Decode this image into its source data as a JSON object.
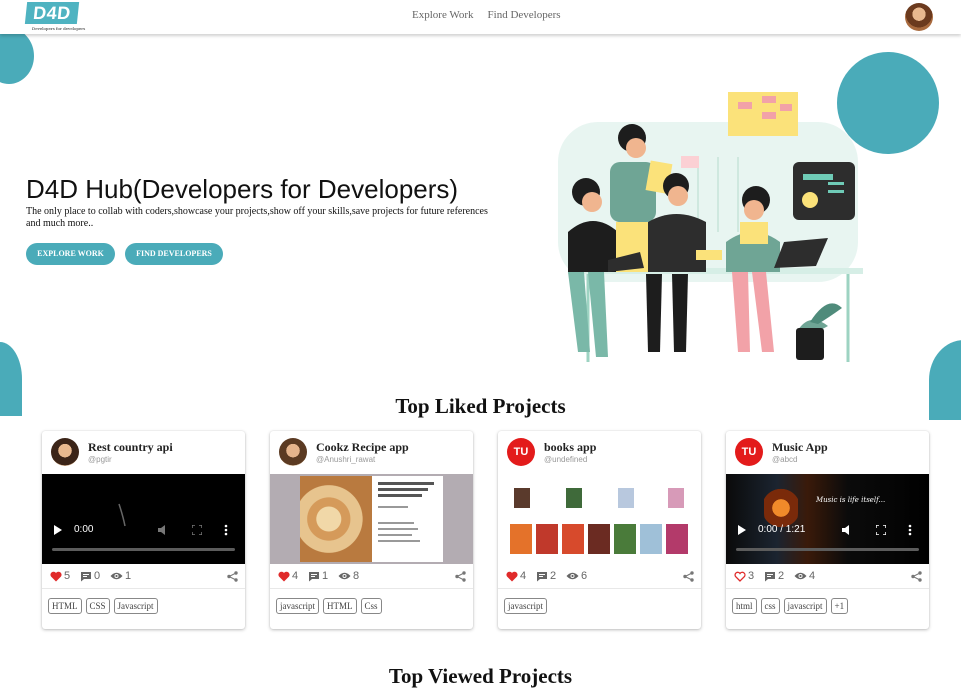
{
  "nav": {
    "logo_text": "D4D",
    "logo_tagline": "Developers for developers",
    "links": [
      "Explore Work",
      "Find Developers"
    ]
  },
  "hero": {
    "title": "D4D Hub(Developers for Developers)",
    "subtitle": "The only place to collab with coders,showcase your projects,show off your skills,save projects for future references and much more..",
    "buttons": [
      "EXPLORE WORK",
      "FIND DEVELOPERS"
    ]
  },
  "sections": {
    "top_liked": "Top Liked Projects",
    "top_viewed": "Top Viewed Projects"
  },
  "cards": [
    {
      "title": "Rest country api",
      "user": "@pgtir",
      "avatar": "photo",
      "media": "video",
      "video_time": "0:00",
      "liked": true,
      "likes": "5",
      "comments": "0",
      "views": "1",
      "tags": [
        "HTML",
        "CSS",
        "Javascript"
      ]
    },
    {
      "title": "Cookz Recipe app",
      "user": "@Anushri_rawat",
      "avatar": "photo",
      "media": "image-recipe",
      "liked": true,
      "likes": "4",
      "comments": "1",
      "views": "8",
      "tags": [
        "javascript",
        "HTML",
        "Css"
      ]
    },
    {
      "title": "books app",
      "user": "@undefined",
      "avatar": "TU",
      "media": "image-books",
      "liked": true,
      "likes": "4",
      "comments": "2",
      "views": "6",
      "tags": [
        "javascript"
      ]
    },
    {
      "title": "Music App",
      "user": "@abcd",
      "avatar": "TU",
      "media": "video-music",
      "video_time": "0:00 / 1:21",
      "video_caption": "Music is life itself...",
      "liked": false,
      "likes": "3",
      "comments": "2",
      "views": "4",
      "tags": [
        "html",
        "css",
        "javascript",
        "+1"
      ]
    }
  ],
  "colors": {
    "accent": "#4aabb9",
    "heart": "#e02b2b",
    "initials_avatar": "#e31b1b"
  },
  "icons": {
    "like": "heart-icon",
    "comment": "comment-icon",
    "views": "eye-icon",
    "share": "share-icon",
    "play": "play-icon",
    "volume": "volume-icon",
    "fullscreen": "fullscreen-icon",
    "more": "more-vertical-icon"
  }
}
